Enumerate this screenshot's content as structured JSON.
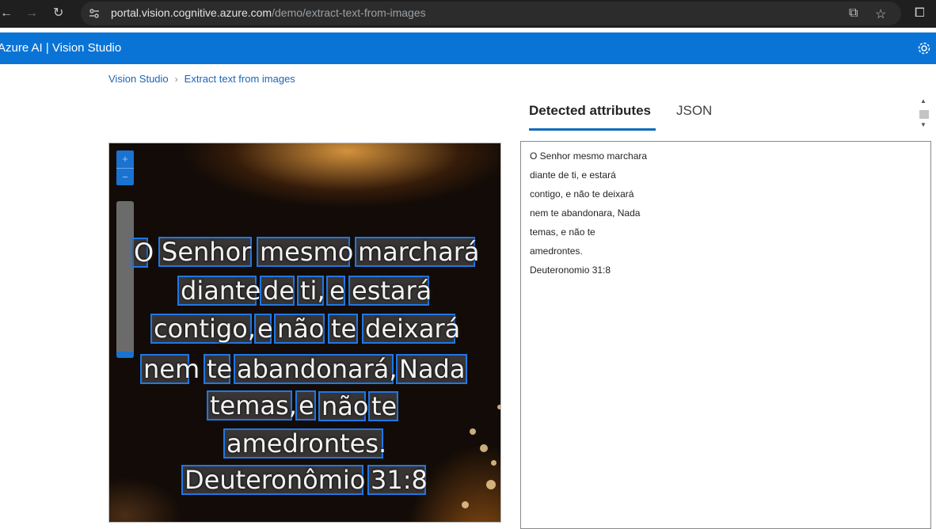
{
  "browser": {
    "url_host": "portal.vision.cognitive.azure.com",
    "url_path": "/demo/extract-text-from-images"
  },
  "app": {
    "title": "Azure AI  |  Vision Studio"
  },
  "breadcrumb": {
    "root": "Vision Studio",
    "separator": "›",
    "current": "Extract text from images"
  },
  "zoom": {
    "plus": "+",
    "minus": "−"
  },
  "image_ocr": {
    "lines": [
      [
        "O",
        "Senhor",
        "mesmo",
        "marchará"
      ],
      [
        "diante",
        "de",
        "ti,",
        "e",
        "estará"
      ],
      [
        "contigo,",
        "e",
        "não",
        "te",
        "deixará"
      ],
      [
        "nem",
        "te",
        "abandonará,",
        "Nada"
      ],
      [
        "temas,",
        "e",
        "não",
        "te"
      ],
      [
        "amedrontes."
      ],
      [
        "Deuteronômio",
        "31:8"
      ]
    ]
  },
  "tabs": {
    "detected": "Detected attributes",
    "json": "JSON"
  },
  "results": {
    "lines": [
      "O Senhor mesmo marchara",
      "diante de ti, e estará",
      "contigo, e não te deixará",
      "nem te abandonara, Nada",
      "temas, e não te",
      "amedrontes.",
      "Deuteronomio 31:8"
    ]
  },
  "colors": {
    "accent": "#0a74d6",
    "ocr_box": "#1f78e6"
  }
}
